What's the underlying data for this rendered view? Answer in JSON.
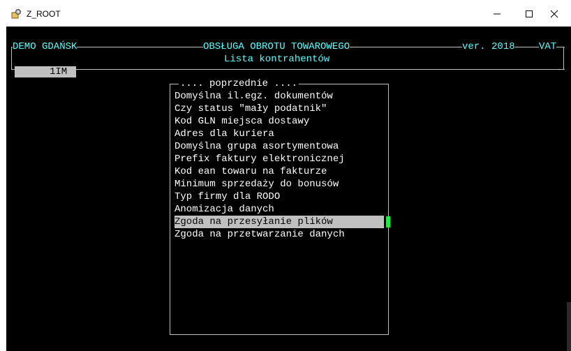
{
  "window": {
    "title": "Z_ROOT",
    "icon": "app-gear-icon"
  },
  "header": {
    "company": "DEMO GDAŃSK",
    "module": "OBSŁUGA OBROTU TOWAROWEGO",
    "version": "ver. 2018",
    "vat": "VAT",
    "screen": "Lista kontrahentów"
  },
  "field": {
    "value": "1IM"
  },
  "menu": {
    "prev_label": ".... poprzednie ....",
    "items": [
      "Domyślna il.egz. dokumentów",
      "Czy status \"mały podatnik\"",
      "Kod GLN miejsca dostawy",
      "Adres dla kuriera",
      "Domyślna grupa asortymentowa",
      "Prefix faktury elektronicznej",
      "Kod ean towaru na fakturze",
      "Minimum sprzedaży do bonusów",
      "Typ firmy dla RODO",
      "Anomizacja danych",
      "Zgoda na przesyłanie plików",
      "Zgoda na przetwarzanie danych"
    ],
    "selected_index": 10
  },
  "colors": {
    "terminal_bg": "#000000",
    "cyan": "#54ffff",
    "highlight": "#c0c0c0",
    "cursor": "#00ff2a"
  }
}
